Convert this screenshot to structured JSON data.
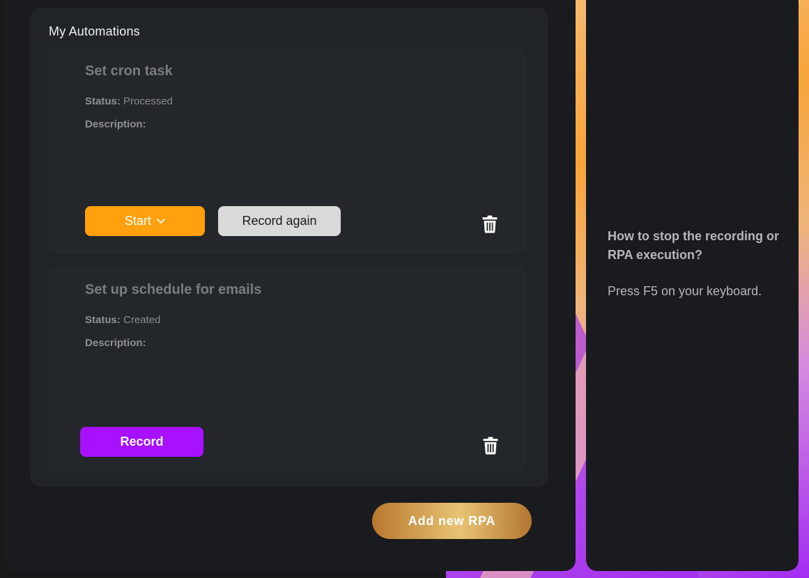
{
  "automations": {
    "title": "My Automations",
    "tasks": [
      {
        "name": "Set cron task",
        "status_label": "Status:",
        "status_value": "Processed",
        "description_label": "Description:",
        "primary_button": "Start",
        "secondary_button": "Record again",
        "delete_icon": "trash-icon"
      },
      {
        "name": "Set up schedule for emails",
        "status_label": "Status:",
        "status_value": "Created",
        "description_label": "Description:",
        "primary_button": "Record",
        "delete_icon": "trash-icon"
      }
    ],
    "add_button": "Add new RPA"
  },
  "help": {
    "question": "How to stop the recording or RPA execution?",
    "answer": "Press F5 on your keyboard."
  },
  "colors": {
    "start_button": "#ffa00e",
    "record_button": "#a711ff",
    "record_again_button": "#d9d9d9",
    "add_button_gold": "#e9c373"
  }
}
